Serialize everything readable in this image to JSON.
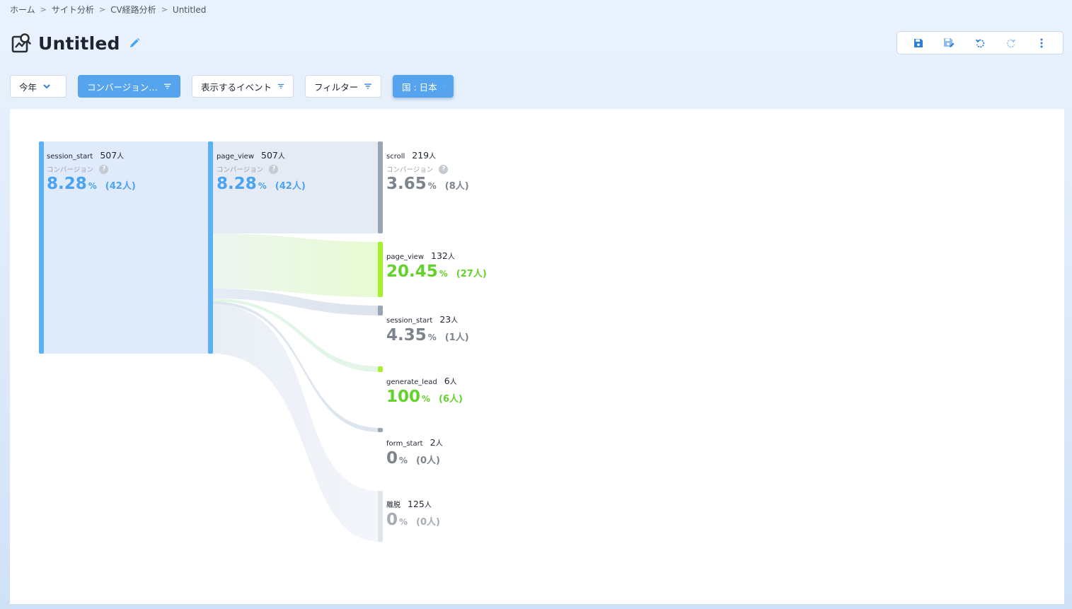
{
  "breadcrumb": [
    "ホーム",
    "サイト分析",
    "CV経路分析",
    "Untitled"
  ],
  "page_title": "Untitled",
  "icons": {
    "page": "chart-report-icon",
    "edit": "pencil-icon",
    "toolbar": [
      "save-icon",
      "save-as-icon",
      "undo-icon",
      "redo-icon",
      "more-vertical-icon"
    ]
  },
  "colors": {
    "accent": "#4aa3f0",
    "green": "#63d22b",
    "gray": "#7d848e",
    "chip_blue": "#56a3ee"
  },
  "filters": {
    "period": "今年",
    "conversion": "コンバージョン…",
    "events": "表示するイベント",
    "filter": "フィルター",
    "country": "国 : 日本"
  },
  "conv_label": "コンバージョン",
  "unit_person": "人",
  "pct_sign": "%",
  "nodes": {
    "n1": {
      "event": "session_start",
      "count": "507",
      "rate": "8.28",
      "conv": "(42人)"
    },
    "n2": {
      "event": "page_view",
      "count": "507",
      "rate": "8.28",
      "conv": "(42人)"
    },
    "t1": {
      "event": "scroll",
      "count": "219",
      "rate": "3.65",
      "conv": "(8人)"
    },
    "t2": {
      "event": "page_view",
      "count": "132",
      "rate": "20.45",
      "conv": "(27人)"
    },
    "t3": {
      "event": "session_start",
      "count": "23",
      "rate": "4.35",
      "conv": "(1人)"
    },
    "t4": {
      "event": "generate_lead",
      "count": "6",
      "rate": "100",
      "conv": "(6人)"
    },
    "t5": {
      "event": "form_start",
      "count": "2",
      "rate": "0",
      "conv": "(0人)"
    },
    "t6": {
      "event": "離脱",
      "count": "125",
      "rate": "0",
      "conv": "(0人)"
    }
  }
}
